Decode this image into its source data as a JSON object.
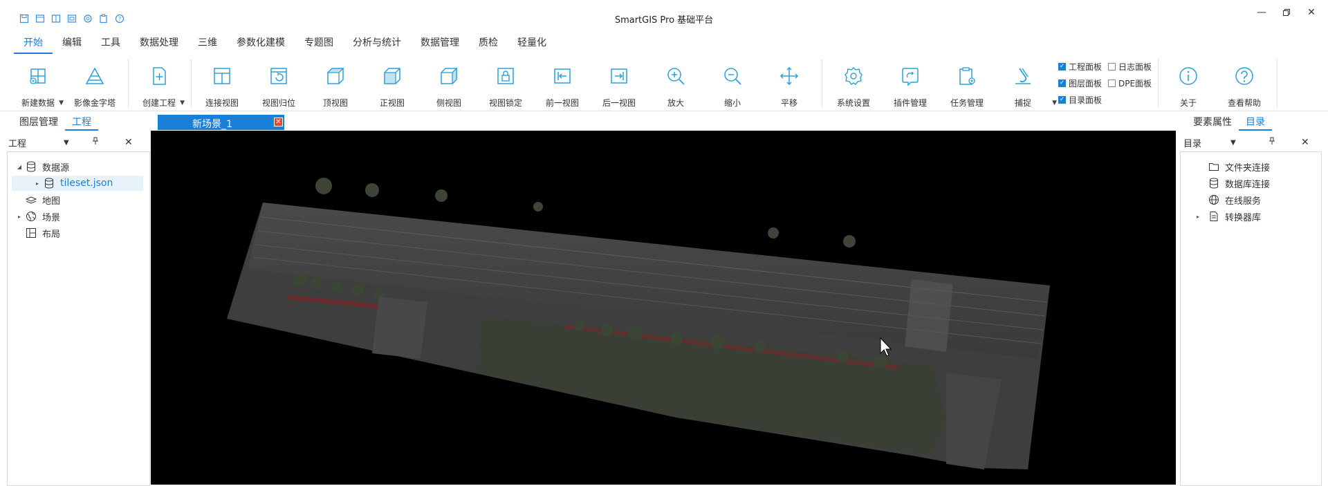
{
  "app": {
    "title": "SmartGIS Pro 基础平台"
  },
  "quick_access": [
    "save-icon",
    "open-icon",
    "layout-icon",
    "export-icon",
    "settings-icon",
    "clipboard-icon",
    "help-icon"
  ],
  "menu": {
    "items": [
      "开始",
      "编辑",
      "工具",
      "数据处理",
      "三维",
      "参数化建模",
      "专题图",
      "分析与统计",
      "数据管理",
      "质检",
      "轻量化"
    ],
    "active": "开始"
  },
  "ribbon": {
    "buttons": [
      {
        "label": "新建数据",
        "icon": "new-data-icon"
      },
      {
        "label": "影像金字塔",
        "icon": "pyramid-icon"
      },
      {
        "label": "创建工程",
        "icon": "create-project-icon"
      },
      {
        "label": "连接视图",
        "icon": "link-view-icon"
      },
      {
        "label": "视图归位",
        "icon": "reset-view-icon"
      },
      {
        "label": "顶视图",
        "icon": "top-view-icon"
      },
      {
        "label": "正视图",
        "icon": "front-view-icon"
      },
      {
        "label": "侧视图",
        "icon": "side-view-icon"
      },
      {
        "label": "视图锁定",
        "icon": "lock-view-icon"
      },
      {
        "label": "前一视图",
        "icon": "previous-view-icon"
      },
      {
        "label": "后一视图",
        "icon": "next-view-icon"
      },
      {
        "label": "放大",
        "icon": "zoom-in-icon"
      },
      {
        "label": "缩小",
        "icon": "zoom-out-icon"
      },
      {
        "label": "平移",
        "icon": "pan-icon"
      },
      {
        "label": "系统设置",
        "icon": "system-settings-icon"
      },
      {
        "label": "插件管理",
        "icon": "plugin-icon"
      },
      {
        "label": "任务管理",
        "icon": "task-icon"
      },
      {
        "label": "捕捉",
        "icon": "snap-icon"
      },
      {
        "label": "关于",
        "icon": "about-icon"
      },
      {
        "label": "查看帮助",
        "icon": "help-icon"
      }
    ],
    "checkboxes": [
      {
        "label": "工程面板",
        "checked": true
      },
      {
        "label": "日志面板",
        "checked": false
      },
      {
        "label": "图层面板",
        "checked": true
      },
      {
        "label": "DPE面板",
        "checked": false
      },
      {
        "label": "目录面板",
        "checked": true
      }
    ]
  },
  "left_panel": {
    "tabs": [
      "图层管理",
      "工程"
    ],
    "active_tab": "工程",
    "header": "工程",
    "tree": [
      {
        "label": "数据源",
        "icon": "database-icon",
        "expanded": true
      },
      {
        "label": "tileset.json",
        "icon": "database-icon",
        "selected": true
      },
      {
        "label": "地图",
        "icon": "map-layers-icon"
      },
      {
        "label": "场景",
        "icon": "globe-icon"
      },
      {
        "label": "布局",
        "icon": "layout-grid-icon"
      }
    ]
  },
  "document": {
    "tab": "新场景_1"
  },
  "right_panel": {
    "tabs": [
      "要素属性",
      "目录"
    ],
    "active_tab": "目录",
    "header": "目录",
    "tree": [
      {
        "label": "文件夹连接",
        "icon": "folder-icon"
      },
      {
        "label": "数据库连接",
        "icon": "database-icon"
      },
      {
        "label": "在线服务",
        "icon": "globe-icon"
      },
      {
        "label": "转换器库",
        "icon": "document-icon"
      }
    ]
  }
}
